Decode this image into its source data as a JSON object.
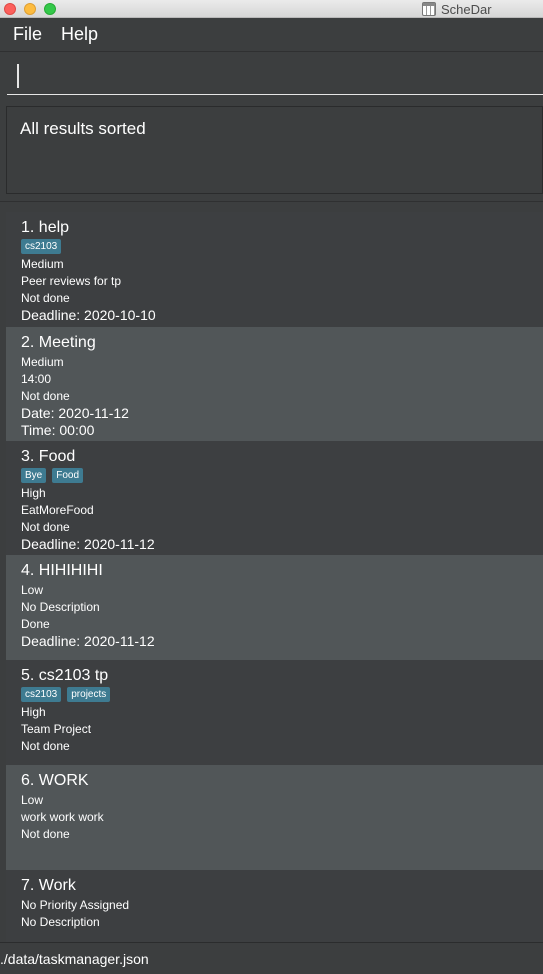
{
  "window": {
    "title": "ScheDar"
  },
  "menu": {
    "file": "File",
    "help": "Help"
  },
  "command": {
    "value": ""
  },
  "result": {
    "text": "All results sorted"
  },
  "tasks": [
    {
      "title": "1.  help",
      "tags": [
        "cs2103"
      ],
      "lines": [
        "Medium",
        "Peer reviews for tp",
        "Not done"
      ],
      "big": [
        "Deadline: 2020-10-10"
      ]
    },
    {
      "title": "2.  Meeting",
      "tags": [],
      "lines": [
        "Medium",
        "14:00",
        "Not done"
      ],
      "big": [
        "Date: 2020-11-12",
        "Time: 00:00"
      ]
    },
    {
      "title": "3.  Food",
      "tags": [
        "Bye",
        "Food"
      ],
      "lines": [
        "High",
        "EatMoreFood",
        "Not done"
      ],
      "big": [
        "Deadline: 2020-11-12"
      ]
    },
    {
      "title": "4.  HIHIHIHI",
      "tags": [],
      "lines": [
        "Low",
        "No Description",
        "Done"
      ],
      "big": [
        "Deadline: 2020-11-12"
      ]
    },
    {
      "title": "5.  cs2103 tp",
      "tags": [
        "cs2103",
        "projects"
      ],
      "lines": [
        "High",
        "Team Project",
        "Not done"
      ],
      "big": []
    },
    {
      "title": "6.  WORK",
      "tags": [],
      "lines": [
        "Low",
        "work work work",
        "Not done"
      ],
      "big": []
    },
    {
      "title": "7.  Work",
      "tags": [],
      "lines": [
        "No Priority Assigned",
        "No Description"
      ],
      "big": []
    }
  ],
  "status": {
    "path": "./data/taskmanager.json"
  }
}
